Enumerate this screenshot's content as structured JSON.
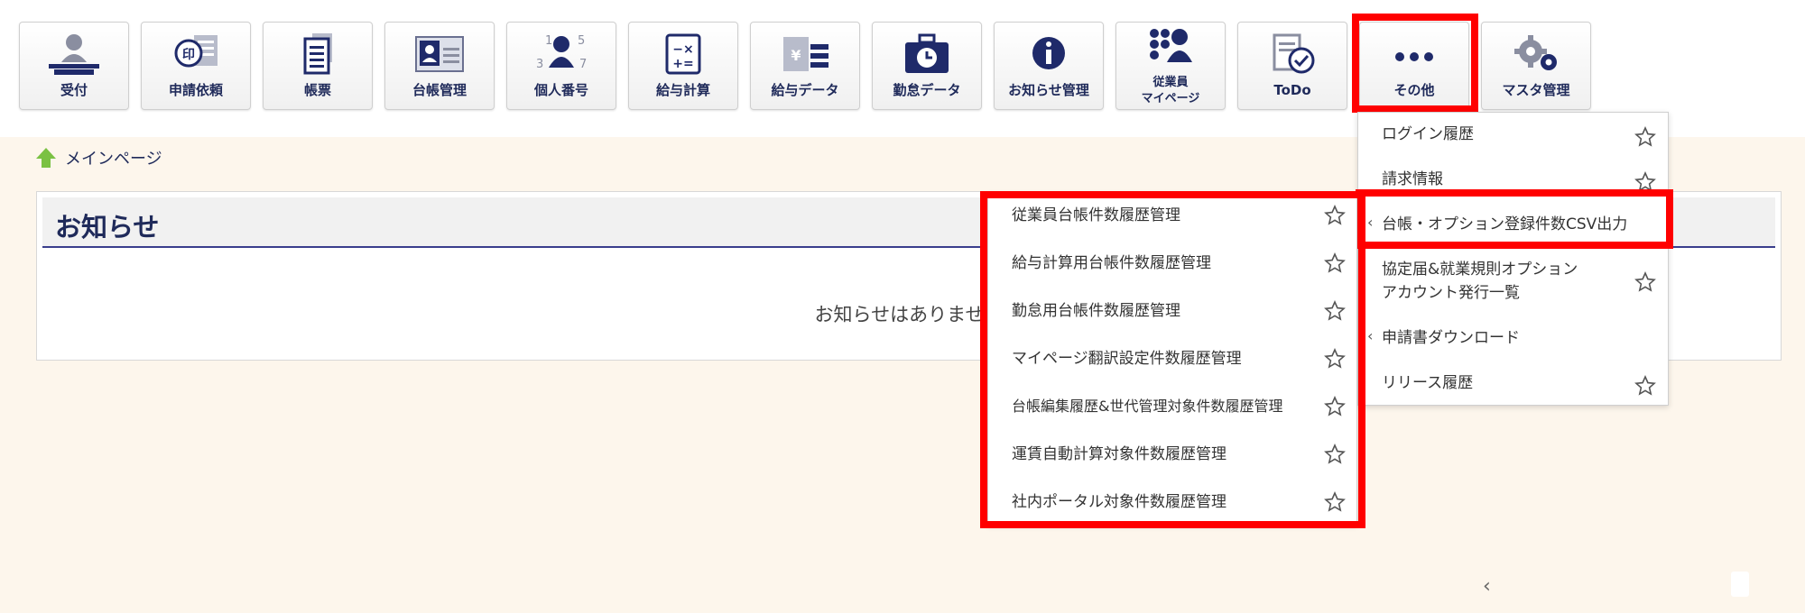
{
  "toolbar": {
    "items": [
      {
        "label": "受付",
        "icon": "person-desk-icon"
      },
      {
        "label": "申請依頼",
        "icon": "stamp-document-icon"
      },
      {
        "label": "帳票",
        "icon": "document-list-icon"
      },
      {
        "label": "台帳管理",
        "icon": "id-card-icon"
      },
      {
        "label": "個人番号",
        "icon": "person-number-icon",
        "digits": [
          "1",
          "3",
          "5",
          "7"
        ]
      },
      {
        "label": "給与計算",
        "icon": "calculator-icon"
      },
      {
        "label": "給与データ",
        "icon": "yen-data-icon"
      },
      {
        "label": "勤怠データ",
        "icon": "clock-briefcase-icon"
      },
      {
        "label": "お知らせ管理",
        "icon": "info-icon"
      },
      {
        "label_line1": "従業員",
        "label_line2": "マイページ",
        "icon": "employee-gear-icon"
      },
      {
        "label": "ToDo",
        "icon": "todo-check-icon"
      },
      {
        "label": "その他",
        "icon": "more-dots-icon"
      },
      {
        "label": "マスタ管理",
        "icon": "gears-icon"
      }
    ]
  },
  "breadcrumb": {
    "home_label": "メインページ"
  },
  "notice": {
    "title": "お知らせ",
    "empty_message": "お知らせはありません"
  },
  "other_menu": {
    "items": [
      {
        "label": "ログイン履歴"
      },
      {
        "label": "請求情報"
      },
      {
        "label": "台帳・オプション登録件数CSV出力",
        "chevron": "‹"
      },
      {
        "label_line1": "協定届&就業規則オプション",
        "label_line2": "アカウント発行一覧"
      },
      {
        "label": "申請書ダウンロード",
        "chevron": "‹"
      },
      {
        "label": "リリース履歴"
      }
    ]
  },
  "submenu": {
    "items": [
      {
        "label": "従業員台帳件数履歴管理"
      },
      {
        "label": "給与計算用台帳件数履歴管理"
      },
      {
        "label": "勤怠用台帳件数履歴管理"
      },
      {
        "label": "マイページ翻訳設定件数履歴管理"
      },
      {
        "label": "台帳編集履歴&世代管理対象件数履歴管理"
      },
      {
        "label": "運賃自動計算対象件数履歴管理"
      },
      {
        "label": "社内ポータル対象件数履歴管理"
      }
    ]
  },
  "footer": {
    "prev_arrow": "‹"
  },
  "colors": {
    "highlight": "#ff0000",
    "navy": "#1f2a5a",
    "background": "#fdf6ec"
  }
}
